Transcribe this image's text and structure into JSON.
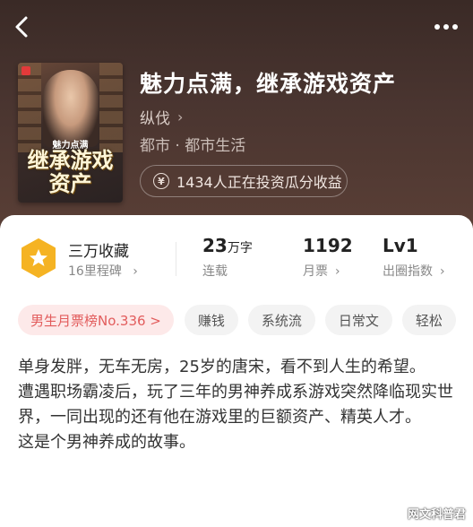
{
  "header": {
    "back_icon": "chevron-left-icon",
    "more_icon": "more-dots-icon"
  },
  "book": {
    "cover_title": "继承游戏资产",
    "cover_top": "魅力点满",
    "title": "魅力点满，继承游戏资产",
    "author": "纵伐",
    "genre": "都市 · 都市生活",
    "invest_text": "1434人正在投资瓜分收益"
  },
  "stats": {
    "favorites_title": "三万收藏",
    "favorites_sub": "16里程碑",
    "word_count_number": "23",
    "word_count_unit": "万字",
    "status": "连载",
    "monthly_votes": "1192",
    "monthly_votes_label": "月票",
    "level": "Lv1",
    "level_label": "出圈指数"
  },
  "tags": [
    "男生月票榜No.336 >",
    "赚钱",
    "系统流",
    "日常文",
    "轻松"
  ],
  "description": [
    "单身发胖，无车无房，25岁的唐宋，看不到人生的希望。",
    "遭遇职场霸凌后，玩了三年的男神养成系游戏突然降临现实世界，一同出现的还有他在游戏里的巨额资产、精英人才。",
    "这是个男神养成的故事。"
  ],
  "watermark": "网文科普君",
  "colors": {
    "hero_bg": "#4a3530",
    "accent_red": "#e25c5c",
    "fav_badge": "#f5b323"
  }
}
